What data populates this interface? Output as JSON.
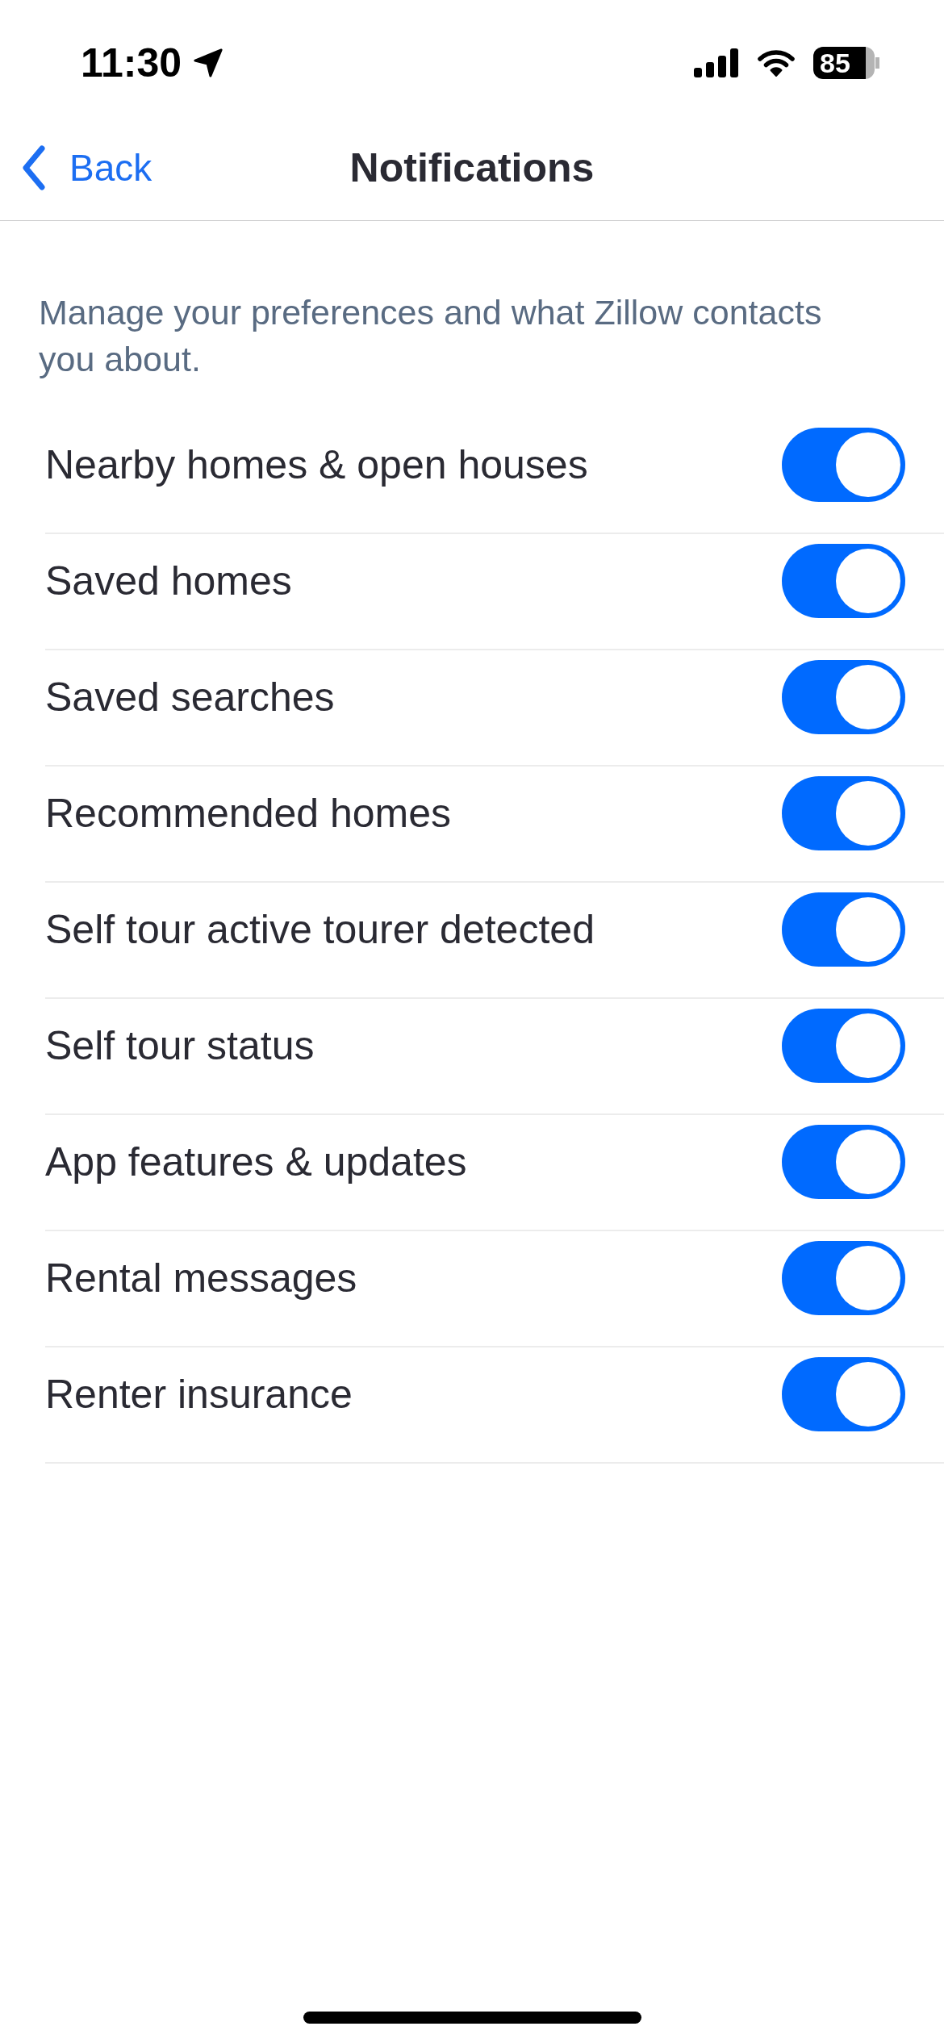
{
  "status_bar": {
    "time": "11:30",
    "battery": "85"
  },
  "nav_bar": {
    "back_label": "Back",
    "title": "Notifications"
  },
  "description": "Manage your preferences and what Zillow contacts you about.",
  "settings": [
    {
      "label": "Nearby homes & open houses",
      "on": true
    },
    {
      "label": "Saved homes",
      "on": true
    },
    {
      "label": "Saved searches",
      "on": true
    },
    {
      "label": "Recommended homes",
      "on": true
    },
    {
      "label": "Self tour active tourer detected",
      "on": true
    },
    {
      "label": "Self tour status",
      "on": true
    },
    {
      "label": "App features & updates",
      "on": true
    },
    {
      "label": "Rental messages",
      "on": true
    },
    {
      "label": "Renter insurance",
      "on": true
    }
  ]
}
